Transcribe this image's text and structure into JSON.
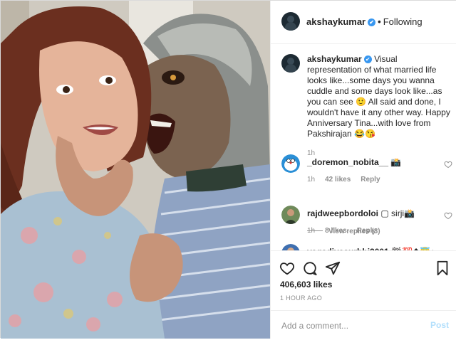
{
  "post": {
    "photo_alt": "",
    "header": {
      "username": "akshaykumar",
      "verified_mark": "✔",
      "separator": "•",
      "follow_status": "Following"
    },
    "caption": {
      "username": "akshaykumar",
      "verified_mark": "✔",
      "text": "Visual representation of what married life looks like...some days you wanna cuddle and some days look like...as you can see 🙂 All said and done, I wouldn't have it any other way. Happy Anniversary Tina...with love from Pakshirajan 😂😘",
      "time": "1h"
    },
    "comments": [
      {
        "username": "_doremon_nobita__",
        "text": "📸",
        "time": "1h",
        "likes": "42 likes",
        "reply": "Reply",
        "view_replies": "View replies (3)"
      },
      {
        "username": "rajdweepbordoloi",
        "text": "▢ sirji📸",
        "time": "1h",
        "likes": "8 likes",
        "reply": "Reply"
      },
      {
        "username": "vagadiyasurbhi2001",
        "text": "🏁💯⬆😇♪",
        "time": "",
        "likes": "",
        "reply": ""
      }
    ],
    "likes_count": "406,603 likes",
    "timestamp": "1 HOUR AGO",
    "add_comment_placeholder": "Add a comment...",
    "post_button": "Post",
    "colors": {
      "verified": "#3897f0",
      "post_button_disabled": "#b2dffc",
      "meta_gray": "#8e8e8e"
    },
    "icons": [
      "heart-icon",
      "comment-icon",
      "share-icon",
      "bookmark-icon"
    ]
  }
}
